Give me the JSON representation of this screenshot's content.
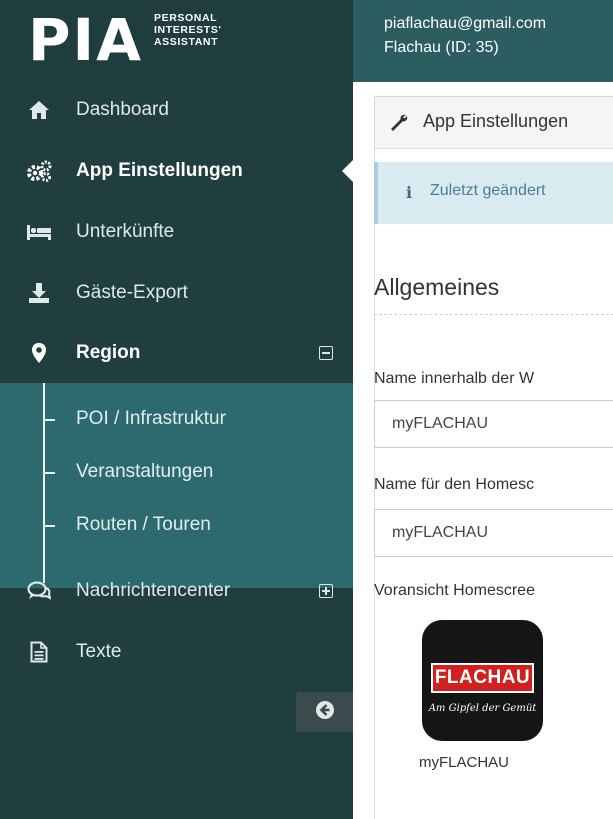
{
  "brand": {
    "logo_text": "PIA",
    "tagline_line1": "PERSONAL",
    "tagline_line2": "INTERESTS'",
    "tagline_line3": "ASSISTANT"
  },
  "header": {
    "email": "piaflachau@gmail.com",
    "region": "Flachau (ID: 35)"
  },
  "sidebar": {
    "items": [
      {
        "label": "Dashboard",
        "icon": "home-icon"
      },
      {
        "label": "App Einstellungen",
        "icon": "cogs-icon",
        "active": true
      },
      {
        "label": "Unterkünfte",
        "icon": "bed-icon"
      },
      {
        "label": "Gäste-Export",
        "icon": "download-icon"
      },
      {
        "label": "Region",
        "icon": "map-marker-icon",
        "expanded": true
      },
      {
        "label": "Nachrichtencenter",
        "icon": "comments-icon",
        "expanded": false
      },
      {
        "label": "Texte",
        "icon": "file-text-icon"
      }
    ],
    "region_submenu": [
      {
        "label": "POI / Infrastruktur"
      },
      {
        "label": "Veranstaltungen"
      },
      {
        "label": "Routen / Touren"
      }
    ]
  },
  "main": {
    "panel_title": "App Einstellungen",
    "info_text": "Zuletzt geändert",
    "section_title": "Allgemeines",
    "fields": [
      {
        "label": "Name innerhalb der W",
        "value": "myFLACHAU"
      },
      {
        "label": "Name für den Homesc",
        "value": "myFLACHAU"
      }
    ],
    "preview_label": "Voransicht Homescree",
    "app_icon": {
      "badge_text": "FLACHAU",
      "script_text": "Am Gipfel der Gemüt",
      "name": "myFLACHAU"
    }
  },
  "colors": {
    "sidebar_bg": "#203e40",
    "submenu_bg": "#2d6a70",
    "topbar_bg": "#2b5d61",
    "info_bg": "#d7ebf1",
    "badge_red": "#d0201f"
  }
}
